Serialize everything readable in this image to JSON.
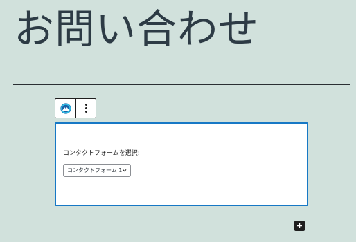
{
  "page": {
    "title": "お問い合わせ"
  },
  "block_toolbar": {
    "block_icon": "contact-form-7-icon",
    "options_icon": "more-vertical-icon"
  },
  "contact_form_block": {
    "label": "コンタクトフォームを選択:",
    "selected_form": "コンタクトフォーム 1"
  },
  "inserter": {
    "icon": "plus-icon"
  },
  "colors": {
    "background": "#d1e1dc",
    "title": "#2d3b45",
    "focus_border": "#1778c5",
    "dark": "#1e1e1e"
  }
}
